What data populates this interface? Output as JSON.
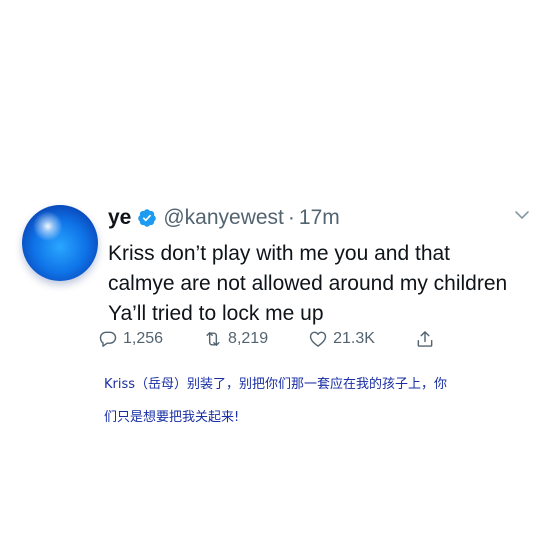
{
  "tweet": {
    "display_name": "ye",
    "handle": "@kanyewest",
    "separator": "·",
    "time": "17m",
    "lines": [
      "Kriss don’t play with me  you and that",
      "calmye are not allowed around my children",
      "Ya’ll tried to lock me up"
    ],
    "replies": "1,256",
    "retweets": "8,219",
    "likes": "21.3K"
  },
  "caption": {
    "line1": "Kriss（岳母）别装了，别把你们那一套应在我的孩子上，你",
    "line2": "们只是想要把我关起来!"
  },
  "colors": {
    "verified": "#1d9bf0",
    "icons": "#536471",
    "caption_text": "#1a2fa3"
  }
}
